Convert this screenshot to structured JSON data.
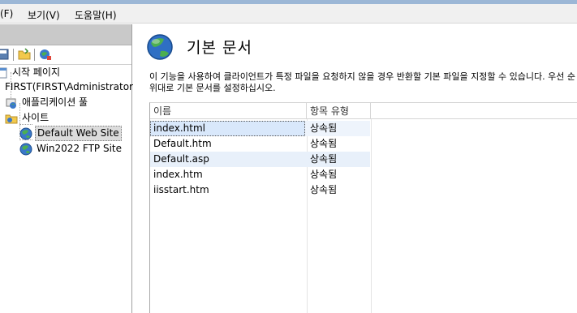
{
  "menu": {
    "items": [
      "(F)",
      "보기(V)",
      "도움말(H)"
    ]
  },
  "connections": {
    "tree": {
      "start_page": "시작 페이지",
      "server": "FIRST(FIRST\\Administrator)",
      "app_pools": "애플리케이션 풀",
      "sites": "사이트",
      "site1": "Default Web Site",
      "site2": "Win2022 FTP Site"
    }
  },
  "main": {
    "title": "기본 문서",
    "description_line1": "이 기능을 사용하여 클라이언트가 특정 파일을 요청하지 않을 경우 반환할 기본 파일을 지정할 수 있습니다. 우선 순",
    "description_line2": "위대로 기본 문서를 설정하십시오.",
    "columns": [
      "이름",
      "항목 유형"
    ],
    "rows": [
      {
        "name": "index.html",
        "type": "상속됨"
      },
      {
        "name": "Default.htm",
        "type": "상속됨"
      },
      {
        "name": "Default.asp",
        "type": "상속됨"
      },
      {
        "name": "index.htm",
        "type": "상속됨"
      },
      {
        "name": "iisstart.htm",
        "type": "상속됨"
      }
    ],
    "selected_row": 0
  },
  "icons": {
    "globe": "globe-icon",
    "folder": "folder-icon",
    "server": "server-icon",
    "app_pool": "app-pool-icon",
    "start_page": "start-page-icon"
  },
  "colors": {
    "selection": "#d9e8fb",
    "alt_row": "#e8f0fa",
    "header_strip": "#c9c9c9"
  }
}
